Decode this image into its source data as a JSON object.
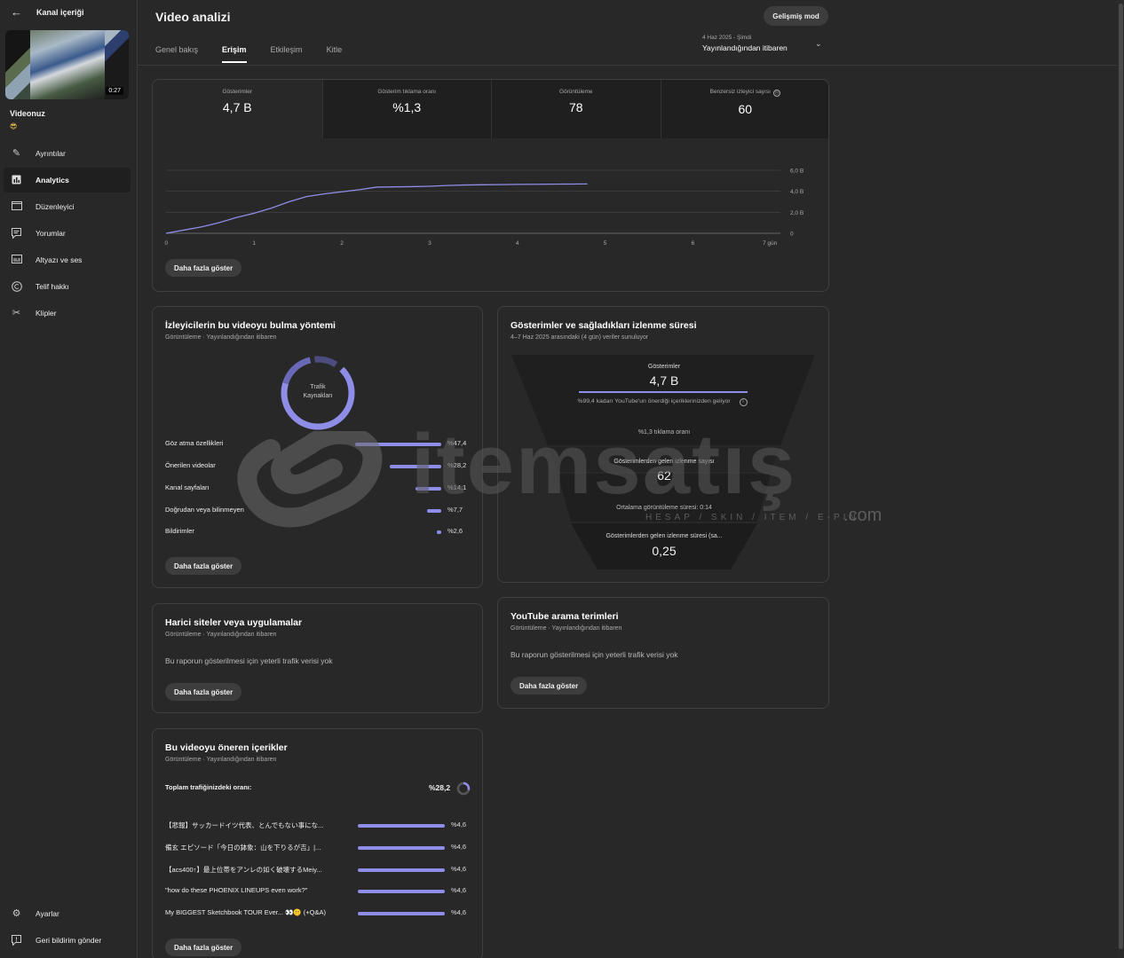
{
  "sidebar": {
    "header": "Kanal içeriği",
    "thumbnail_duration": "0:27",
    "video_label": "Videonuz",
    "items": [
      {
        "label": "Ayrıntılar",
        "icon": "pencil-icon"
      },
      {
        "label": "Analytics",
        "icon": "analytics-icon"
      },
      {
        "label": "Düzenleyici",
        "icon": "editor-icon"
      },
      {
        "label": "Yorumlar",
        "icon": "comments-icon"
      },
      {
        "label": "Altyazı ve ses",
        "icon": "subtitles-icon"
      },
      {
        "label": "Telif hakkı",
        "icon": "copyright-icon"
      },
      {
        "label": "Klipler",
        "icon": "scissors-icon"
      }
    ],
    "bottom": [
      {
        "label": "Ayarlar",
        "icon": "gear-icon"
      },
      {
        "label": "Geri bildirim gönder",
        "icon": "feedback-icon"
      }
    ]
  },
  "header": {
    "title": "Video analizi",
    "advanced_mode": "Gelişmiş mod",
    "tabs": [
      "Genel bakış",
      "Erişim",
      "Etkileşim",
      "Kitle"
    ],
    "date_small": "4 Haz 2025 - Şimdi",
    "date_big": "Yayınlandığından itibaren"
  },
  "metrics": [
    {
      "label": "Gösterimler",
      "value": "4,7 B"
    },
    {
      "label": "Gösterim tıklama oranı",
      "value": "%1,3"
    },
    {
      "label": "Görüntüleme",
      "value": "78"
    },
    {
      "label": "Benzersiz izleyici sayısı",
      "value": "60"
    }
  ],
  "chart_data": {
    "type": "line",
    "x": [
      0,
      0.2,
      0.4,
      0.6,
      0.8,
      1.0,
      1.2,
      1.4,
      1.6,
      1.8,
      2.0,
      2.2,
      2.4,
      2.6,
      2.8,
      3.0,
      3.2,
      3.4,
      3.6,
      3.8,
      4.0,
      4.2,
      4.4,
      4.6,
      4.8
    ],
    "series": [
      {
        "values": [
          0,
          0.3,
          0.6,
          1.0,
          1.5,
          1.9,
          2.4,
          3.0,
          3.5,
          3.75,
          3.95,
          4.15,
          4.4,
          4.42,
          4.44,
          4.48,
          4.55,
          4.6,
          4.62,
          4.64,
          4.66,
          4.67,
          4.68,
          4.69,
          4.7
        ]
      }
    ],
    "xticks": [
      "0",
      "1",
      "2",
      "3",
      "4",
      "5",
      "6",
      "7 gün"
    ],
    "yticks": [
      "0",
      "2,0 B",
      "4,0 B",
      "6,0 B"
    ],
    "xlim": [
      0,
      7
    ],
    "ylim": [
      0,
      6
    ],
    "grid": true
  },
  "more_label": "Daha fazla göster",
  "traffic": {
    "title": "İzleyicilerin bu videoyu bulma yöntemi",
    "subtitle": "Görüntüleme · Yayınlandığından itibaren",
    "donut_label_1": "Trafik",
    "donut_label_2": "Kaynakları",
    "rows": [
      {
        "label": "Göz atma özellikleri",
        "value": "%47,4",
        "share": 0.474
      },
      {
        "label": "Önerilen videolar",
        "value": "%28,2",
        "share": 0.282
      },
      {
        "label": "Kanal sayfaları",
        "value": "%14,1",
        "share": 0.141
      },
      {
        "label": "Doğrudan veya bilinmeyen",
        "value": "%7,7",
        "share": 0.077
      },
      {
        "label": "Bildirimler",
        "value": "%2,6",
        "share": 0.026
      }
    ]
  },
  "funnel": {
    "title": "Gösterimler ve sağladıkları izlenme süresi",
    "subtitle": "4–7 Haz 2025 arasındaki (4 gün) veriler sunuluyor",
    "impressions_label": "Gösterimler",
    "impressions_value": "4,7 B",
    "impressions_note": "%99,4 kadarı YouTube'un önerdiği içeriklerinizden geliyor",
    "ctr": "%1,3 tıklama oranı",
    "views_label": "Gösterimlerden gelen izlenme sayısı",
    "views_value": "62",
    "avg_watch": "Ortalama görüntüleme süresi: 0:14",
    "watch_label": "Gösterimlerden gelen izlenme süresi (sa...",
    "watch_value": "0,25"
  },
  "external": {
    "title": "Harici siteler veya uygulamalar",
    "subtitle": "Görüntüleme · Yayınlandığından itibaren",
    "empty": "Bu raporun gösterilmesi için yeterli trafik verisi yok"
  },
  "search_terms": {
    "title": "YouTube arama terimleri",
    "subtitle": "Görüntüleme · Yayınlandığından itibaren",
    "empty": "Bu raporun gösterilmesi için yeterli trafik verisi yok"
  },
  "recommended": {
    "title": "Bu videoyu öneren içerikler",
    "subtitle": "Görüntüleme · Yayınlandığından itibaren",
    "total_label": "Toplam trafiğinizdeki oranı:",
    "total_value": "%28,2",
    "rows": [
      {
        "label": "【悲報】サッカードイツ代表、とんでもない事にな...",
        "value": "%4,6"
      },
      {
        "label": "備玄 エピソード「今日の鉢象：山を下りるが吉」|...",
        "value": "%4,6"
      },
      {
        "label": "【acs400↑】最上位帯をアンレの如く破壊するMeiy...",
        "value": "%4,6"
      },
      {
        "label": "\"how do these PHOENIX LINEUPS even work?\"",
        "value": "%4,6"
      },
      {
        "label": "My BIGGEST Sketchbook TOUR Ever... 👀🤫 (+Q&A)",
        "value": "%4,6"
      }
    ]
  },
  "watermark": {
    "brand": "itemsatış",
    "tagline": "HESAP / SKIN / ITEM / E-PIN",
    "suffix": ".com"
  },
  "colors": {
    "accent": "#8e8de8",
    "background": "#282828"
  }
}
